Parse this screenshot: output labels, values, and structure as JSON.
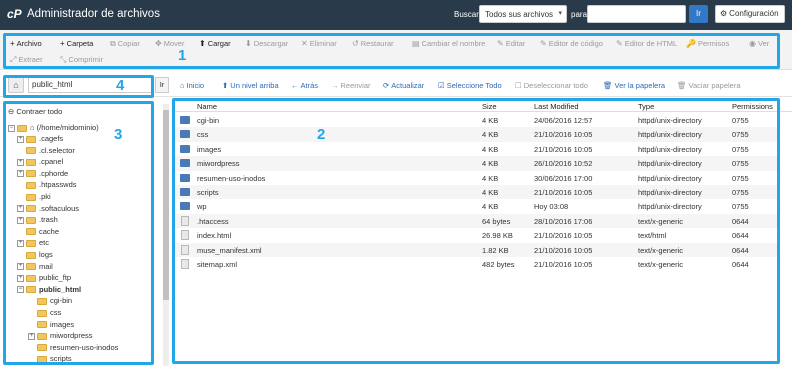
{
  "header": {
    "logo": "cP",
    "title": "Administrador de archivos",
    "search_label": "Buscar",
    "search_scope": "Todos sus archivos",
    "for_label": "para",
    "search_value": "",
    "go_label": "Ir",
    "config_label": "Configuración"
  },
  "toolbar": {
    "row1": [
      {
        "label": "Archivo",
        "icon": "+",
        "enabled": true
      },
      {
        "label": "Carpeta",
        "icon": "+",
        "enabled": true
      },
      {
        "label": "Copiar",
        "icon": "⧉",
        "enabled": false
      },
      {
        "label": "Mover",
        "icon": "✥",
        "enabled": false
      },
      {
        "label": "Cargar",
        "icon": "⬆",
        "enabled": true
      },
      {
        "label": "Descargar",
        "icon": "⬇",
        "enabled": false
      },
      {
        "label": "Eliminar",
        "icon": "✕",
        "enabled": false
      },
      {
        "label": "Restaurar",
        "icon": "↺",
        "enabled": false
      },
      {
        "label": "Cambiar el nombre",
        "icon": "▤",
        "enabled": false
      },
      {
        "label": "Editar",
        "icon": "✎",
        "enabled": false
      },
      {
        "label": "Editor de código",
        "icon": "✎",
        "enabled": false
      },
      {
        "label": "Editor de HTML",
        "icon": "✎",
        "enabled": false
      },
      {
        "label": "Permisos",
        "icon": "🔑",
        "enabled": false
      },
      {
        "label": "Ver",
        "icon": "◉",
        "enabled": false
      }
    ],
    "row2": [
      {
        "label": "Extraer",
        "icon": "⤢",
        "enabled": false
      },
      {
        "label": "Comprimir",
        "icon": "⤡",
        "enabled": false
      }
    ]
  },
  "path": {
    "value": "public_html",
    "go_label": "Ir"
  },
  "nav": [
    {
      "label": "Inicio",
      "icon": "⌂",
      "enabled": true
    },
    {
      "label": "Un nivel arriba",
      "icon": "⬆",
      "enabled": true
    },
    {
      "label": "Atrás",
      "icon": "←",
      "enabled": true
    },
    {
      "label": "Reenviar",
      "icon": "→",
      "enabled": false
    },
    {
      "label": "Actualizar",
      "icon": "⟳",
      "enabled": true
    },
    {
      "label": "Seleccione Todo",
      "icon": "☑",
      "enabled": true
    },
    {
      "label": "Deseleccionar todo",
      "icon": "☐",
      "enabled": false
    },
    {
      "label": "Ver la papelera",
      "icon": "🗑",
      "enabled": true
    },
    {
      "label": "Vaciar papelera",
      "icon": "🗑",
      "enabled": false
    }
  ],
  "tree": {
    "collapse_label": "Contraer todo",
    "root": "(/home/midominio)",
    "items": [
      {
        "label": ".cagefs",
        "pm": "+",
        "depth": 1
      },
      {
        "label": ".cl.selector",
        "pm": "",
        "depth": 1
      },
      {
        "label": ".cpanel",
        "pm": "+",
        "depth": 1
      },
      {
        "label": ".cphorde",
        "pm": "+",
        "depth": 1
      },
      {
        "label": ".htpasswds",
        "pm": "",
        "depth": 1
      },
      {
        "label": ".pki",
        "pm": "",
        "depth": 1
      },
      {
        "label": ".softaculous",
        "pm": "+",
        "depth": 1
      },
      {
        "label": ".trash",
        "pm": "+",
        "depth": 1
      },
      {
        "label": "cache",
        "pm": "",
        "depth": 1
      },
      {
        "label": "etc",
        "pm": "+",
        "depth": 1
      },
      {
        "label": "logs",
        "pm": "",
        "depth": 1
      },
      {
        "label": "mail",
        "pm": "+",
        "depth": 1
      },
      {
        "label": "public_ftp",
        "pm": "+",
        "depth": 1
      },
      {
        "label": "public_html",
        "pm": "−",
        "depth": 1,
        "bold": true
      },
      {
        "label": "cgi-bin",
        "pm": "",
        "depth": 2
      },
      {
        "label": "css",
        "pm": "",
        "depth": 2
      },
      {
        "label": "images",
        "pm": "",
        "depth": 2
      },
      {
        "label": "miwordpress",
        "pm": "+",
        "depth": 2
      },
      {
        "label": "resumen-uso-inodos",
        "pm": "",
        "depth": 2
      },
      {
        "label": "scripts",
        "pm": "",
        "depth": 2
      }
    ]
  },
  "table": {
    "headers": [
      "Name",
      "Size",
      "Last Modified",
      "Type",
      "Permissions"
    ],
    "rows": [
      {
        "name": "cgi-bin",
        "size": "4 KB",
        "modified": "24/06/2016 12:57",
        "type": "httpd/unix-directory",
        "perm": "0755",
        "kind": "dir"
      },
      {
        "name": "css",
        "size": "4 KB",
        "modified": "21/10/2016 10:05",
        "type": "httpd/unix-directory",
        "perm": "0755",
        "kind": "dir"
      },
      {
        "name": "images",
        "size": "4 KB",
        "modified": "21/10/2016 10:05",
        "type": "httpd/unix-directory",
        "perm": "0755",
        "kind": "dir"
      },
      {
        "name": "miwordpress",
        "size": "4 KB",
        "modified": "26/10/2016 10:52",
        "type": "httpd/unix-directory",
        "perm": "0755",
        "kind": "dir"
      },
      {
        "name": "resumen-uso-inodos",
        "size": "4 KB",
        "modified": "30/06/2016 17:00",
        "type": "httpd/unix-directory",
        "perm": "0755",
        "kind": "dir"
      },
      {
        "name": "scripts",
        "size": "4 KB",
        "modified": "21/10/2016 10:05",
        "type": "httpd/unix-directory",
        "perm": "0755",
        "kind": "dir"
      },
      {
        "name": "wp",
        "size": "4 KB",
        "modified": "Hoy 03:08",
        "type": "httpd/unix-directory",
        "perm": "0755",
        "kind": "dir"
      },
      {
        "name": ".htaccess",
        "size": "64 bytes",
        "modified": "28/10/2016 17:06",
        "type": "text/x-generic",
        "perm": "0644",
        "kind": "file"
      },
      {
        "name": "index.html",
        "size": "26.98 KB",
        "modified": "21/10/2016 10:05",
        "type": "text/html",
        "perm": "0644",
        "kind": "file"
      },
      {
        "name": "muse_manifest.xml",
        "size": "1.82 KB",
        "modified": "21/10/2016 10:05",
        "type": "text/x-generic",
        "perm": "0644",
        "kind": "file"
      },
      {
        "name": "sitemap.xml",
        "size": "482 bytes",
        "modified": "21/10/2016 10:05",
        "type": "text/x-generic",
        "perm": "0644",
        "kind": "file"
      }
    ]
  },
  "annotations": [
    "1",
    "2",
    "3",
    "4"
  ],
  "colors": {
    "header_bg": "#293a4a",
    "accent": "#22a6e8",
    "link": "#2a6ab8",
    "folder": "#4a7ab5"
  }
}
